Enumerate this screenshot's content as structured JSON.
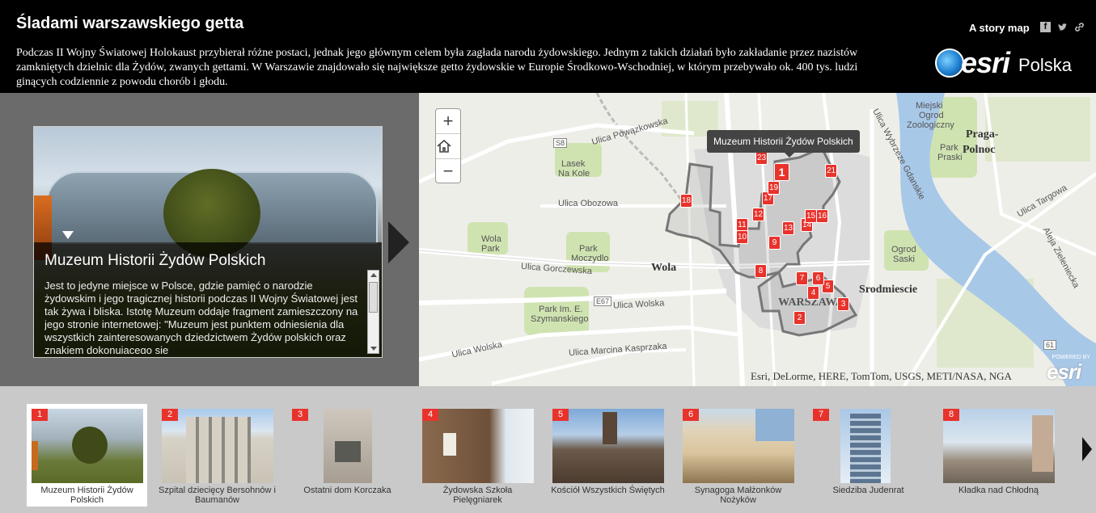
{
  "header": {
    "title": "Śladami warszawskiego getta",
    "intro": "Podczas II Wojny Światowej Holokaust przybierał różne postaci, jednak jego głównym celem była zagłada narodu żydowskiego. Jednym z takich działań było zakładanie przez nazistów zamkniętych dzielnic dla Żydów, zwanych gettami. W Warszawie znajdowało się największe getto żydowskie w Europie Środkowo-Wschodniej, w którym przebywało ok. 400 tys. ludzi ginących codziennie z powodu chorób i głodu.",
    "story_map_label": "A story map",
    "share_icons": [
      "facebook-icon",
      "twitter-icon",
      "link-icon"
    ],
    "logo_word": "esri",
    "logo_country": "Polska"
  },
  "detail": {
    "title": "Muzeum Historii Żydów Polskich",
    "text": "Jest to jedyne miejsce w Polsce, gdzie pamięć o narodzie żydowskim i jego tragicznej historii podczas II Wojny Światowej jest tak żywa i bliska. Istotę Muzeum oddaje fragment zamieszczony na jego stronie internetowej: \"Muzeum jest punktem odniesienia dla wszystkich zainteresowanych dziedzictwem Żydów polskich oraz znakiem dokonującego się"
  },
  "map": {
    "zoom_in": "+",
    "zoom_out": "−",
    "home_icon": "home-icon",
    "tooltip": "Muzeum Historii Żydów Polskich",
    "attribution": "Esri, DeLorme, HERE, TomTom, USGS, METI/NASA, NGA",
    "powered_by": "POWERED BY",
    "powered_esri": "esri",
    "labels": {
      "wola": "Wola",
      "srodmiescie": "Srodmiescie",
      "praga1": "Praga-",
      "praga2": "Polnoc",
      "warszawa": "WARSZAWA",
      "lasek1": "Lasek",
      "lasek2": "Na Kole",
      "wolapark1": "Wola",
      "wolapark2": "Park",
      "moczydlo1": "Park",
      "moczydlo2": "Moczydlo",
      "szym1": "Park Im. E.",
      "szym2": "Szymanskiego",
      "saski1": "Ogrod",
      "saski2": "Saski",
      "zoo1": "Miejski",
      "zoo2": "Ogrod",
      "zoo3": "Zoologiczny",
      "praski1": "Park",
      "praski2": "Praski",
      "obozowa": "Ulica Obozowa",
      "gorczewska": "Ulica Gorczewska",
      "wolska": "Ulica Wolska",
      "wolska2": "Ulica Wolska",
      "kasprzaka": "Ulica Marcina Kasprzaka",
      "powazkowska": "Ulica Powązkowska",
      "targowa": "Ulica Targowa",
      "zielenicka": "Aleja Zieleniecka",
      "gdanska": "Ulica Wybrzeze Gdanskie",
      "s8": "S8",
      "e67": "E67",
      "r61": "61"
    },
    "pins": [
      {
        "n": "1",
        "active": true
      },
      {
        "n": "2"
      },
      {
        "n": "3"
      },
      {
        "n": "4"
      },
      {
        "n": "5"
      },
      {
        "n": "6"
      },
      {
        "n": "7"
      },
      {
        "n": "8"
      },
      {
        "n": "9"
      },
      {
        "n": "11"
      },
      {
        "n": "10"
      },
      {
        "n": "12"
      },
      {
        "n": "13"
      },
      {
        "n": "14"
      },
      {
        "n": "15"
      },
      {
        "n": "16"
      },
      {
        "n": "17"
      },
      {
        "n": "18"
      },
      {
        "n": "19"
      },
      {
        "n": "21"
      },
      {
        "n": "23"
      }
    ]
  },
  "carousel": {
    "items": [
      {
        "n": "1",
        "label": "Muzeum Historii Żydów Polskich",
        "active": true
      },
      {
        "n": "2",
        "label": "Szpital dziecięcy Bersohnów i Baumanów"
      },
      {
        "n": "3",
        "label": "Ostatni dom Korczaka"
      },
      {
        "n": "4",
        "label": "Żydowska Szkoła Pielęgniarek"
      },
      {
        "n": "5",
        "label": "Kościół Wszystkich Świętych"
      },
      {
        "n": "6",
        "label": "Synagoga Małżonków Nożyków"
      },
      {
        "n": "7",
        "label": "Siedziba Judenrat"
      },
      {
        "n": "8",
        "label": "Kładka nad Chłodną"
      }
    ]
  },
  "colors": {
    "accent": "#e8332c",
    "header_bg": "#000000",
    "panel_bg": "#6b6b6b",
    "carousel_bg": "#c9c9c9"
  }
}
